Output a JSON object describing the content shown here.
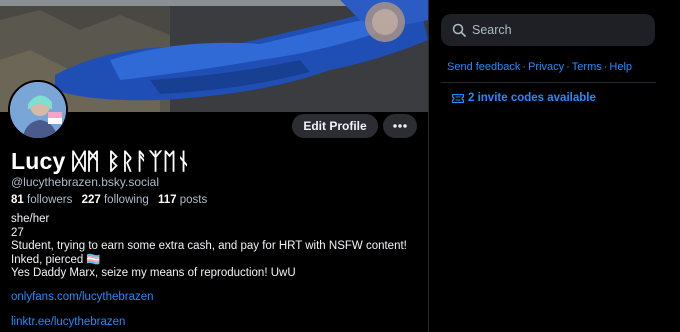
{
  "profile": {
    "display_name": "Lucy ᛞᛗ ᛒᚱᚨᛉᛖᚾ",
    "handle": "@lucythebrazen.bsky.social",
    "followers_count": "81",
    "followers_label": "followers",
    "following_count": "227",
    "following_label": "following",
    "posts_count": "117",
    "posts_label": "posts",
    "edit_button": "Edit Profile",
    "more_icon": "ellipsis-icon",
    "bio_lines": [
      "she/her",
      "27",
      "Student, trying to earn some extra cash, and pay for HRT with NSFW content!",
      "Inked, pierced 🏳️‍⚧️",
      "Yes Daddy Marx, seize my means of reproduction! UwU"
    ],
    "links": [
      "onlyfans.com/lucythebrazen",
      "linktr.ee/lucythebrazen"
    ]
  },
  "sidebar": {
    "search_placeholder": "Search",
    "footer_links": [
      "Send feedback",
      "Privacy",
      "Terms",
      "Help"
    ],
    "invite_text": "2 invite codes available"
  },
  "colors": {
    "background": "#000000",
    "accent_link": "#208bfe",
    "button_bg": "#2b2d33",
    "muted_text": "#aebbc9"
  }
}
